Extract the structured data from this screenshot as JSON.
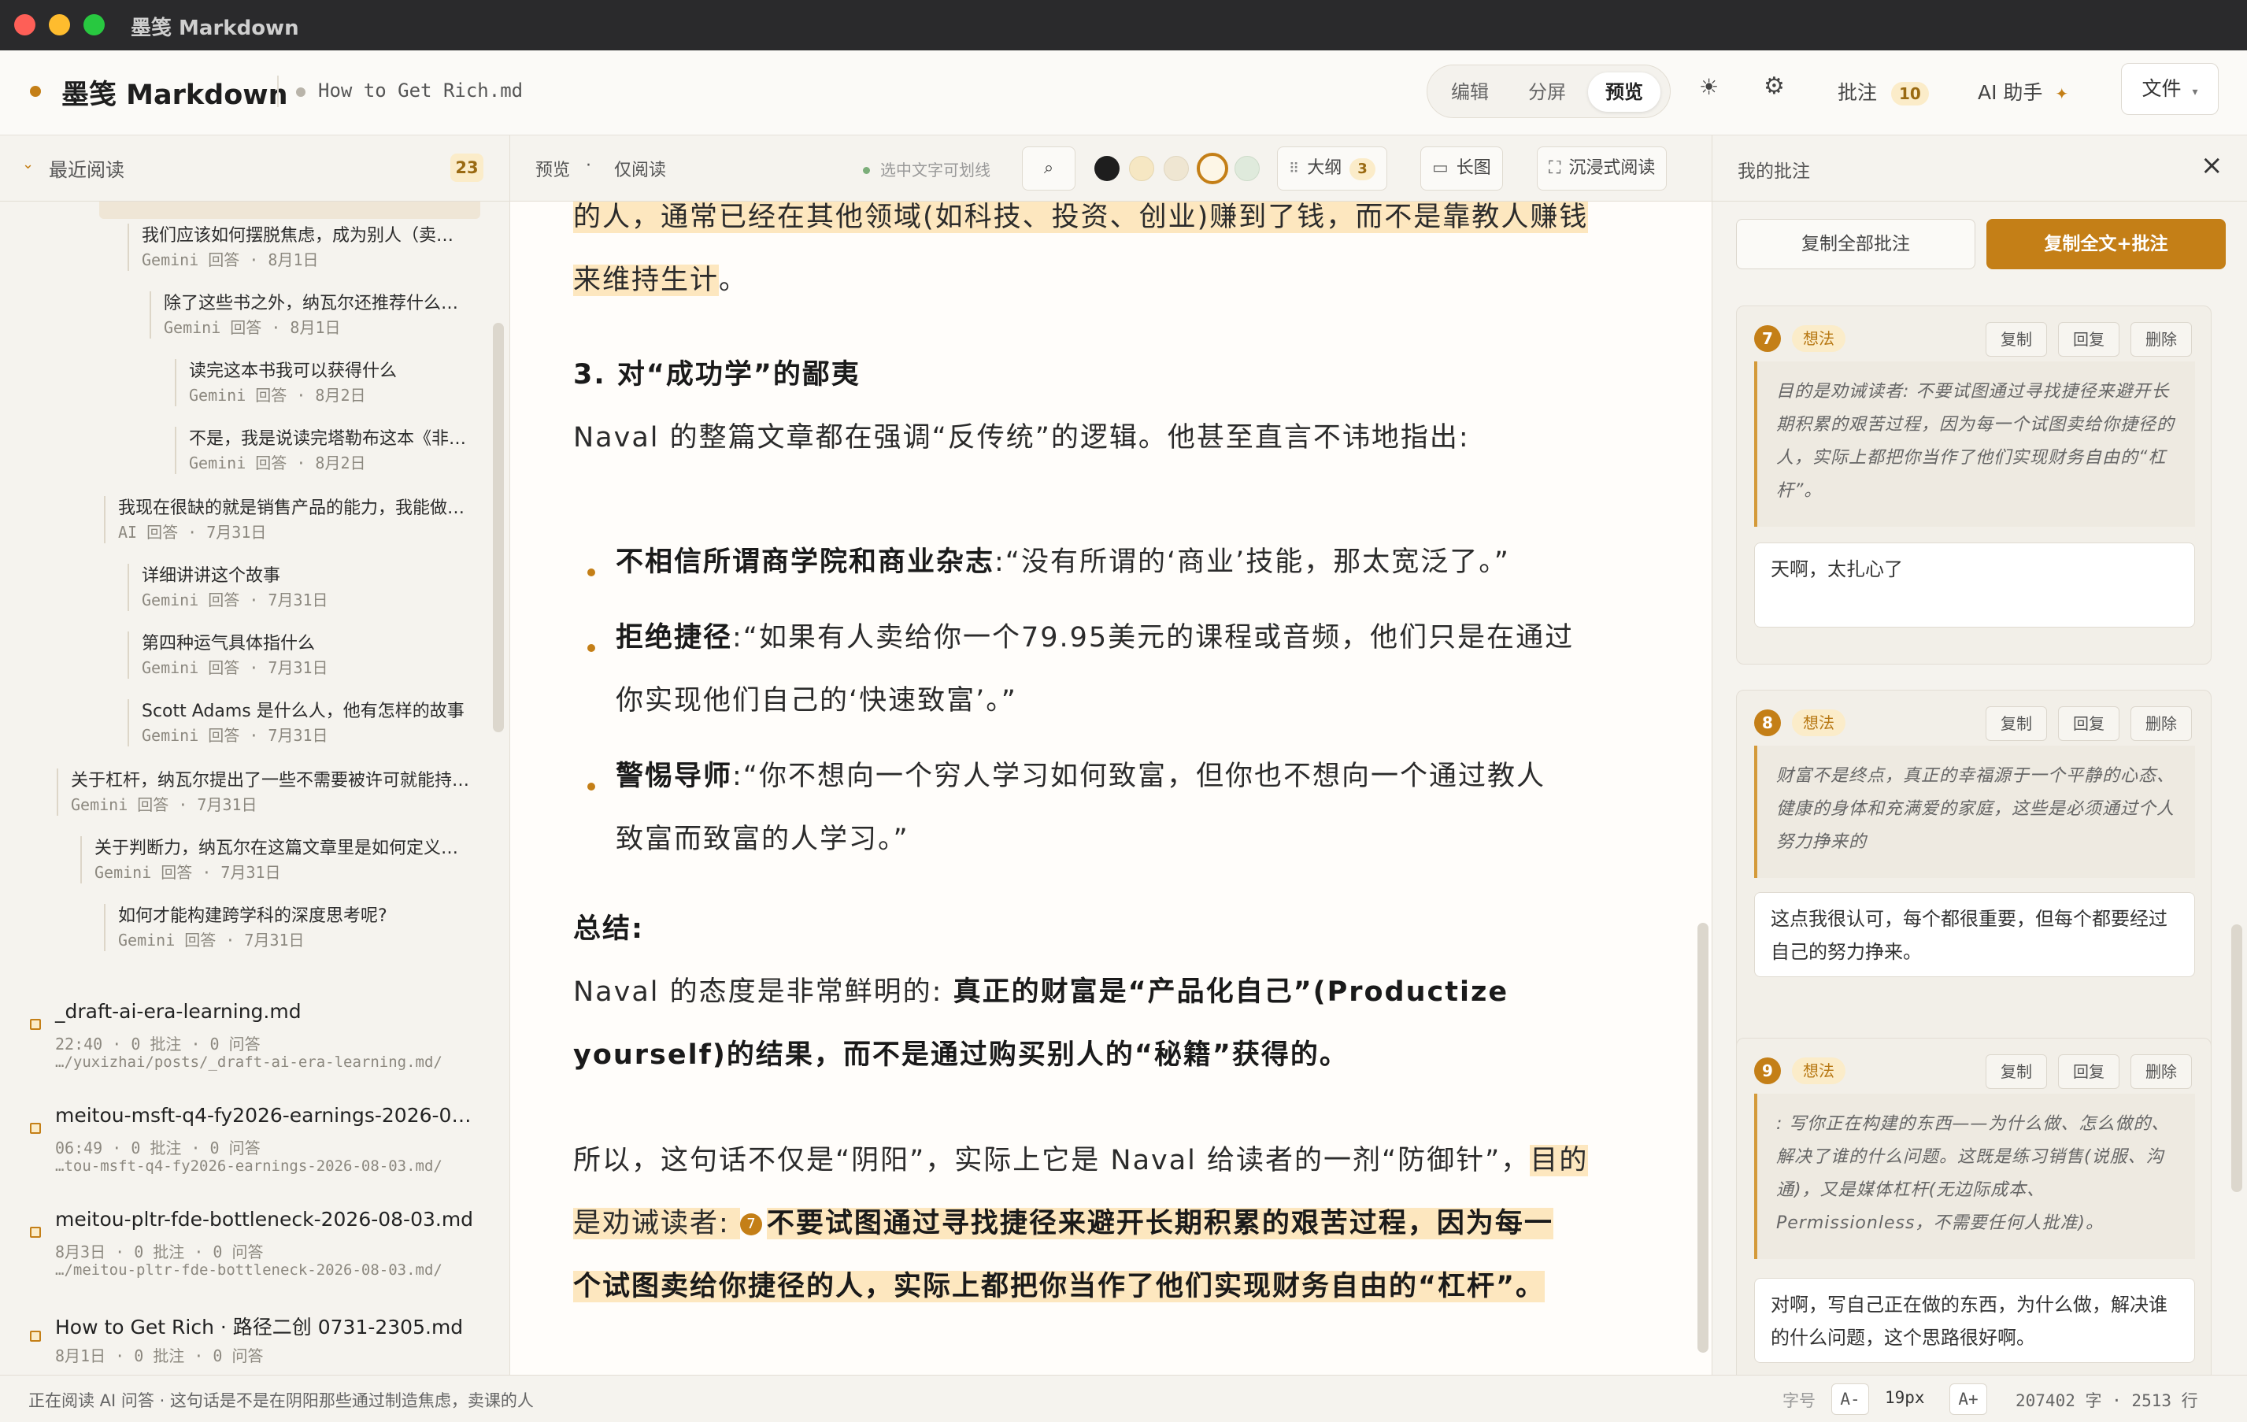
{
  "window": {
    "title": "墨笺 Markdown"
  },
  "header": {
    "app_name": "墨笺 Markdown",
    "file_name": "How to Get Rich.md",
    "modes": [
      "编辑",
      "分屏",
      "预览"
    ],
    "active_mode": "预览",
    "theme_icon": "sun-icon",
    "settings_icon": "gear-icon",
    "annotations_label": "批注",
    "annotations_count": "10",
    "ai_label": "AI 助手",
    "ai_icon": "sparkle-icon",
    "file_label": "文件"
  },
  "sidebar": {
    "title": "最近阅读",
    "count": "23",
    "tree": [
      {
        "title": "我们应该如何摆脱焦虑，成为别人（卖…",
        "meta": "Gemini 回答 · 8月1日"
      },
      {
        "title": "除了这些书之外，纳瓦尔还推荐什么…",
        "meta": "Gemini 回答 · 8月1日"
      },
      {
        "title": "读完这本书我可以获得什么",
        "meta": "Gemini 回答 · 8月2日"
      },
      {
        "title": "不是，我是说读完塔勒布这本《非…",
        "meta": "Gemini 回答 · 8月2日"
      },
      {
        "title": "我现在很缺的就是销售产品的能力，我能做…",
        "meta": "AI 回答 · 7月31日"
      },
      {
        "title": "详细讲讲这个故事",
        "meta": "Gemini 回答 · 7月31日"
      },
      {
        "title": "第四种运气具体指什么",
        "meta": "Gemini 回答 · 7月31日"
      },
      {
        "title": "Scott Adams 是什么人，他有怎样的故事",
        "meta": "Gemini 回答 · 7月31日"
      },
      {
        "title": "关于杠杆，纳瓦尔提出了一些不需要被许可就能持…",
        "meta": "Gemini 回答 · 7月31日"
      },
      {
        "title": "关于判断力，纳瓦尔在这篇文章里是如何定义…",
        "meta": "Gemini 回答 · 7月31日"
      },
      {
        "title": "如何才能构建跨学科的深度思考呢?",
        "meta": "Gemini 回答 · 7月31日"
      }
    ],
    "files": [
      {
        "name": "_draft-ai-era-learning.md",
        "meta": "22:40 · 0 批注 · 0 问答",
        "path": "…/yuxizhai/posts/_draft-ai-era-learning.md/"
      },
      {
        "name": "meitou-msft-q4-fy2026-earnings-2026-0…",
        "meta": "06:49 · 0 批注 · 0 问答",
        "path": "…tou-msft-q4-fy2026-earnings-2026-08-03.md/"
      },
      {
        "name": "meitou-pltr-fde-bottleneck-2026-08-03.md",
        "meta": "8月3日 · 0 批注 · 0 问答",
        "path": "…/meitou-pltr-fde-bottleneck-2026-08-03.md/"
      },
      {
        "name": "How to Get Rich · 路径二创 0731-2305.md",
        "meta": "8月1日 · 0 批注 · 0 问答",
        "path": ""
      }
    ]
  },
  "toolbar": {
    "preview_label": "预览",
    "readonly_label": "仅阅读",
    "hint": "选中文字可划线",
    "colors": [
      "#1e1e1e",
      "#f6e7c3",
      "#efe6d2",
      "#fdf6e6",
      "#dfeadc"
    ],
    "outline_label": "大纲",
    "outline_count": "3",
    "longimg_label": "长图",
    "immersive_label": "沉浸式阅读"
  },
  "content": {
    "l1": "的人，通常已经在其他领域(如科技、投资、创业)赚到了钱，而不是靠教人赚钱",
    "l2": "来维持生计",
    "l2_tail": "。",
    "h3": "3. 对“成功学”的鄙夷",
    "p1": "Naval 的整篇文章都在强调“反传统”的逻辑。他甚至直言不讳地指出:",
    "b1_bold": "不相信所谓商学院和商业杂志",
    "b1_text": ":“没有所谓的‘商业’技能，那太宽泛了。”",
    "b2_bold": "拒绝捷径",
    "b2_text": ":“如果有人卖给你一个79.95美元的课程或音频，他们只是在通过",
    "b2_cont": "你实现他们自己的‘快速致富’。”",
    "b3_bold": "警惕导师",
    "b3_text": ":“你不想向一个穷人学习如何致富，但你也不想向一个通过教人",
    "b3_cont": "致富而致富的人学习。”",
    "summary_label": "总结:",
    "s1_text": "Naval 的态度是非常鲜明的: ",
    "s1_bold": "真正的财富是“产品化自己”(Productize",
    "s2_bold": "yourself)的结果，而不是通过购买别人的“秘籍”获得的。",
    "p2_text": "所以，这句话不仅是“阴阳”，实际上它是 Naval 给读者的一剂“防御针”，",
    "p2_hl": "目的",
    "p3_hl": "是劝诫读者: ",
    "p3_num": "7",
    "p3_bold": "不要试图通过寻找捷径来避开长期积累的艰苦过程，因为每一",
    "p4_bold": "个试图卖给你捷径的人，实际上都把你当作了他们实现财务自由的“杠杆”。"
  },
  "annotations": {
    "title": "我的批注",
    "copy_all": "复制全部批注",
    "copy_full": "复制全文+批注",
    "actions": [
      "复制",
      "回复",
      "删除"
    ],
    "cards": [
      {
        "num": "7",
        "tag": "想法",
        "quote": "目的是劝诫读者: 不要试图通过寻找捷径来避开长期积累的艰苦过程，因为每一个试图卖给你捷径的人，实际上都把你当作了他们实现财务自由的“杠杆”。",
        "reply": "天啊，太扎心了"
      },
      {
        "num": "8",
        "tag": "想法",
        "quote": "财富不是终点，真正的幸福源于一个平静的心态、健康的身体和充满爱的家庭，这些是必须通过个人努力挣来的",
        "reply": "这点我很认可，每个都很重要，但每个都要经过自己的努力挣来。"
      },
      {
        "num": "9",
        "tag": "想法",
        "quote": ": 写你正在构建的东西——为什么做、怎么做的、解决了谁的什么问题。这既是练习销售(说服、沟通)，又是媒体杠杆(无边际成本、Permissionless，不需要任何人批准)。",
        "reply": "对啊，写自己正在做的东西，为什么做，解决谁的什么问题，这个思路很好啊。"
      }
    ]
  },
  "status": {
    "left": "正在阅读 AI 问答 · 这句话是不是在阴阳那些通过制造焦虑，卖课的人",
    "font_label": "字号",
    "dec": "A-",
    "size": "19px",
    "inc": "A+",
    "stats": "207402 字 · 2513 行"
  }
}
